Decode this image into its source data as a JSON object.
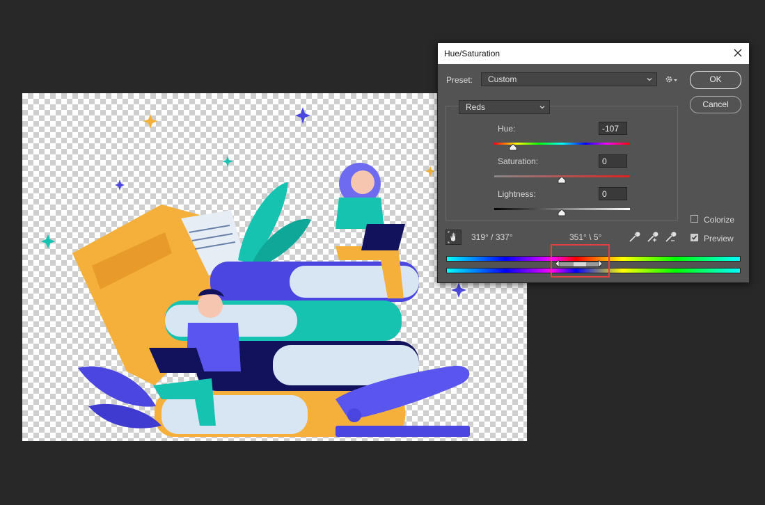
{
  "dialog": {
    "title": "Hue/Saturation",
    "preset_label": "Preset:",
    "preset_value": "Custom",
    "ok_label": "OK",
    "cancel_label": "Cancel",
    "channel_value": "Reds",
    "hue_label": "Hue:",
    "hue_value": "-107",
    "saturation_label": "Saturation:",
    "saturation_value": "0",
    "lightness_label": "Lightness:",
    "lightness_value": "0",
    "colorize_label": "Colorize",
    "colorize_checked": false,
    "preview_label": "Preview",
    "preview_checked": true,
    "range_left": "319° / 337°",
    "range_right": "351° \\ 5°"
  },
  "icons": {
    "close": "close-icon",
    "gear": "gear-icon",
    "hand": "targeted-adjustment-hand-icon",
    "eyedropper": "eyedropper-icon",
    "eyedropper_plus": "eyedropper-plus-icon",
    "eyedropper_minus": "eyedropper-minus-icon"
  },
  "colors": {
    "workspace_bg": "#282828",
    "dialog_bg": "#535353",
    "highlight_box": "#e04040"
  }
}
